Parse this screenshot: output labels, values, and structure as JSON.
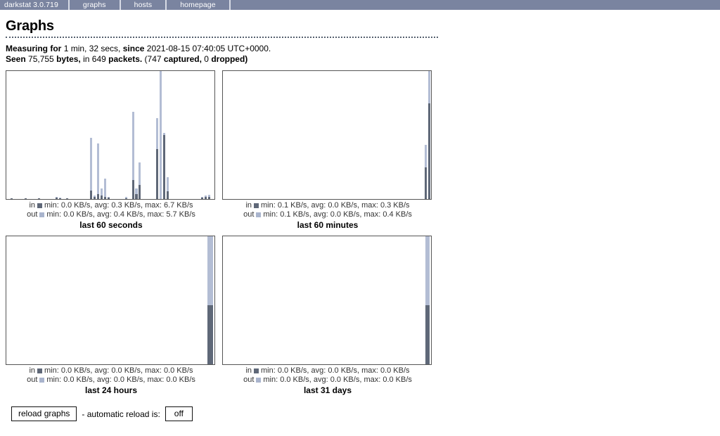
{
  "nav": {
    "brand": "darkstat 3.0.719",
    "items": [
      {
        "label": "graphs"
      },
      {
        "label": "hosts"
      },
      {
        "label": "homepage"
      }
    ]
  },
  "header": {
    "title": "Graphs"
  },
  "summary": {
    "measuring_label": "Measuring for",
    "measuring_value": "1 min, 32 secs,",
    "since_label": "since",
    "since_value": "2021-08-15 07:40:05 UTC+0000.",
    "seen_label": "Seen",
    "bytes_value": "75,755",
    "bytes_label": "bytes,",
    "in_label": "in",
    "packets_value": "649",
    "packets_label": "packets.",
    "captured_open": "(747",
    "captured_label": "captured,",
    "dropped_value": "0",
    "dropped_label": "dropped)"
  },
  "legend_common": {
    "in_label": "in",
    "out_label": "out",
    "min_label": "min:",
    "avg_label": "avg:",
    "max_label": "max:"
  },
  "controls": {
    "reload_button": "reload graphs",
    "separator_text": "- automatic reload is:",
    "auto_reload_state": "off"
  },
  "colors": {
    "in": "#5f6878",
    "out": "#b3bdd4",
    "nav_bg": "#7a84a0",
    "border": "#555555"
  },
  "chart_data": [
    {
      "id": "last-60-seconds",
      "type": "bar",
      "title": "last 60 seconds",
      "unit": "KB/s",
      "series": [
        {
          "name": "in",
          "min": "0.0 KB/s",
          "avg": "0.3 KB/s",
          "max": "6.7 KB/s"
        },
        {
          "name": "out",
          "min": "0.0 KB/s",
          "avg": "0.4 KB/s",
          "max": "5.7 KB/s"
        }
      ],
      "bar_count": 60,
      "ymax": 6.7,
      "bars": [
        {
          "i": 1,
          "in": 0.05,
          "out": 0.05
        },
        {
          "i": 5,
          "in": 0.05,
          "out": 0.05
        },
        {
          "i": 9,
          "in": 0.05,
          "out": 0.05
        },
        {
          "i": 14,
          "in": 0.09,
          "out": 0.12
        },
        {
          "i": 15,
          "in": 0.05,
          "out": 0.06
        },
        {
          "i": 17,
          "in": 0.05,
          "out": 0.05
        },
        {
          "i": 24,
          "in": 0.45,
          "out": 3.2
        },
        {
          "i": 25,
          "in": 0.1,
          "out": 0.2
        },
        {
          "i": 26,
          "in": 0.25,
          "out": 2.9
        },
        {
          "i": 27,
          "in": 0.2,
          "out": 0.55
        },
        {
          "i": 28,
          "in": 0.1,
          "out": 1.05
        },
        {
          "i": 29,
          "in": 0.06,
          "out": 0.1
        },
        {
          "i": 34,
          "in": 0.05,
          "out": 0.12
        },
        {
          "i": 36,
          "in": 1.0,
          "out": 4.55
        },
        {
          "i": 37,
          "in": 0.25,
          "out": 0.55
        },
        {
          "i": 38,
          "in": 0.75,
          "out": 1.9
        },
        {
          "i": 43,
          "in": 2.6,
          "out": 4.25
        },
        {
          "i": 44,
          "in": 0.0,
          "out": 6.7
        },
        {
          "i": 45,
          "in": 3.35,
          "out": 3.45
        },
        {
          "i": 46,
          "in": 0.4,
          "out": 1.15
        },
        {
          "i": 56,
          "in": 0.07,
          "out": 0.1
        },
        {
          "i": 57,
          "in": 0.12,
          "out": 0.17
        },
        {
          "i": 58,
          "in": 0.1,
          "out": 0.22
        }
      ]
    },
    {
      "id": "last-60-minutes",
      "type": "bar",
      "title": "last 60 minutes",
      "unit": "KB/s",
      "series": [
        {
          "name": "in",
          "min": "0.1 KB/s",
          "avg": "0.0 KB/s",
          "max": "0.3 KB/s"
        },
        {
          "name": "out",
          "min": "0.1 KB/s",
          "avg": "0.0 KB/s",
          "max": "0.4 KB/s"
        }
      ],
      "bar_count": 60,
      "ymax": 0.4,
      "bars": [
        {
          "i": 58,
          "in": 0.1,
          "out": 0.17
        },
        {
          "i": 59,
          "in": 0.3,
          "out": 0.4
        }
      ]
    },
    {
      "id": "last-24-hours",
      "type": "bar",
      "title": "last 24 hours",
      "unit": "KB/s",
      "series": [
        {
          "name": "in",
          "min": "0.0 KB/s",
          "avg": "0.0 KB/s",
          "max": "0.0 KB/s"
        },
        {
          "name": "out",
          "min": "0.0 KB/s",
          "avg": "0.0 KB/s",
          "max": "0.0 KB/s"
        }
      ],
      "bar_count": 24,
      "ymax": 1.0,
      "bars": [
        {
          "i": 23,
          "in": 0.46,
          "out": 1.0
        }
      ]
    },
    {
      "id": "last-31-days",
      "type": "bar",
      "title": "last 31 days",
      "unit": "KB/s",
      "series": [
        {
          "name": "in",
          "min": "0.0 KB/s",
          "avg": "0.0 KB/s",
          "max": "0.0 KB/s"
        },
        {
          "name": "out",
          "min": "0.0 KB/s",
          "avg": "0.0 KB/s",
          "max": "0.0 KB/s"
        }
      ],
      "bar_count": 31,
      "ymax": 1.0,
      "bars": [
        {
          "i": 30,
          "in": 0.46,
          "out": 1.0
        }
      ]
    }
  ]
}
